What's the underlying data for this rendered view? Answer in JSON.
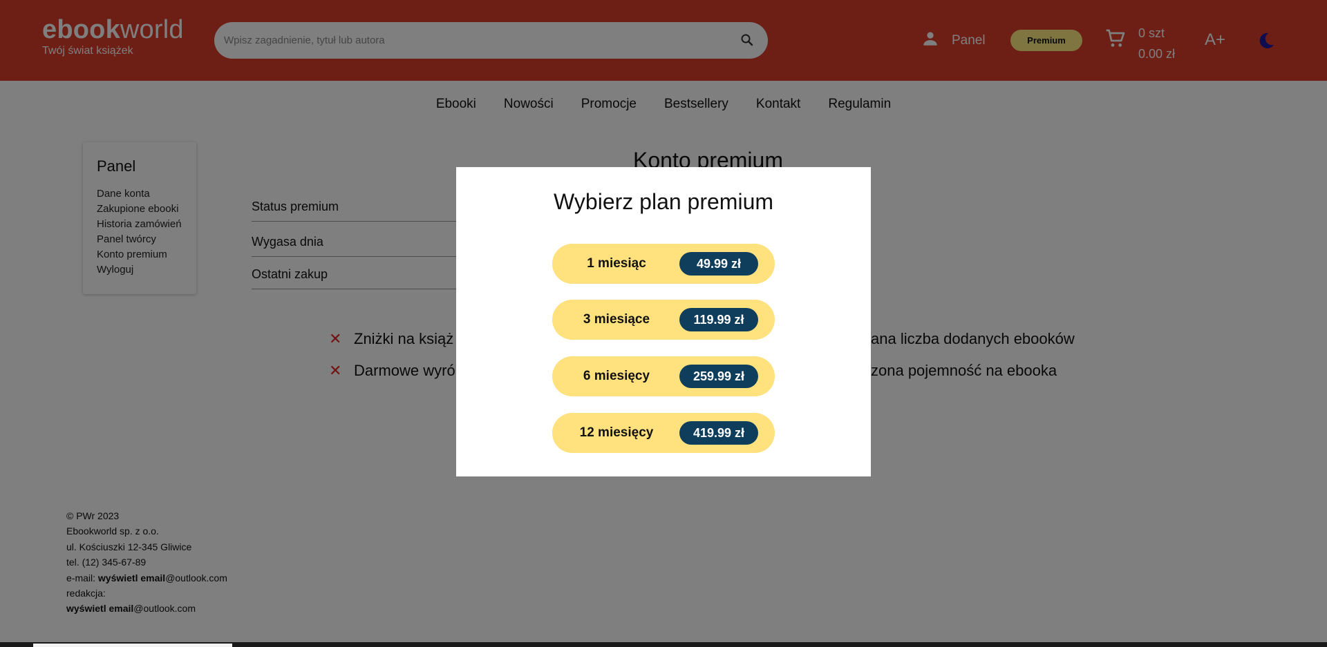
{
  "header": {
    "logo_bold": "ebook",
    "logo_light": "world",
    "tagline": "Twój świat książek",
    "search_placeholder": "Wpisz zagadnienie, tytuł lub autora",
    "panel_label": "Panel",
    "premium_label": "Premium",
    "cart_count": "0 szt",
    "cart_total": "0.00 zł",
    "font_size_label": "A+"
  },
  "nav": [
    "Ebooki",
    "Nowości",
    "Promocje",
    "Bestsellery",
    "Kontakt",
    "Regulamin"
  ],
  "sidebar": {
    "title": "Panel",
    "items": [
      "Dane konta",
      "Zakupione ebooki",
      "Historia zamówień",
      "Panel twórcy",
      "Konto premium",
      "Wyloguj"
    ]
  },
  "main": {
    "title": "Konto premium",
    "rows": [
      "Status premium",
      "Wygasa dnia",
      "Ostatni zakup"
    ],
    "benefits_left": [
      "Zniżki na książ",
      "Darmowe wyró"
    ],
    "benefits_right": [
      "ana liczba dodanych ebooków",
      "zona pojemność na ebooka"
    ]
  },
  "footer": {
    "copyright": "© PWr 2023",
    "company": "Ebookworld sp. z o.o.",
    "address": "ul. Kościuszki 12-345 Gliwice",
    "phone": "tel. (12) 345-67-89",
    "email_prefix": "e-mail: ",
    "email_link": "wyświetl email",
    "email_domain": "@outlook.com",
    "editorial_label": "redakcja:",
    "editorial_link": "wyświetl email",
    "editorial_domain": "@outlook.com"
  },
  "modal": {
    "title": "Wybierz plan premium",
    "plans": [
      {
        "label": "1 miesiąc",
        "price": "49.99 zł"
      },
      {
        "label": "3 miesiące",
        "price": "119.99 zł"
      },
      {
        "label": "6 miesięcy",
        "price": "259.99 zł"
      },
      {
        "label": "12 miesięcy",
        "price": "419.99 zł"
      }
    ]
  },
  "colors": {
    "header": "#da3e2c",
    "premium_badge": "#ffeb80",
    "plan_bg": "#ffe17e",
    "price_bg": "#0f3d5c",
    "benefit_x": "#e22222",
    "moon_icon": "#1a1aa0"
  },
  "icons": [
    "search-icon",
    "user-icon",
    "cart-icon",
    "moon-icon",
    "close-icon"
  ]
}
